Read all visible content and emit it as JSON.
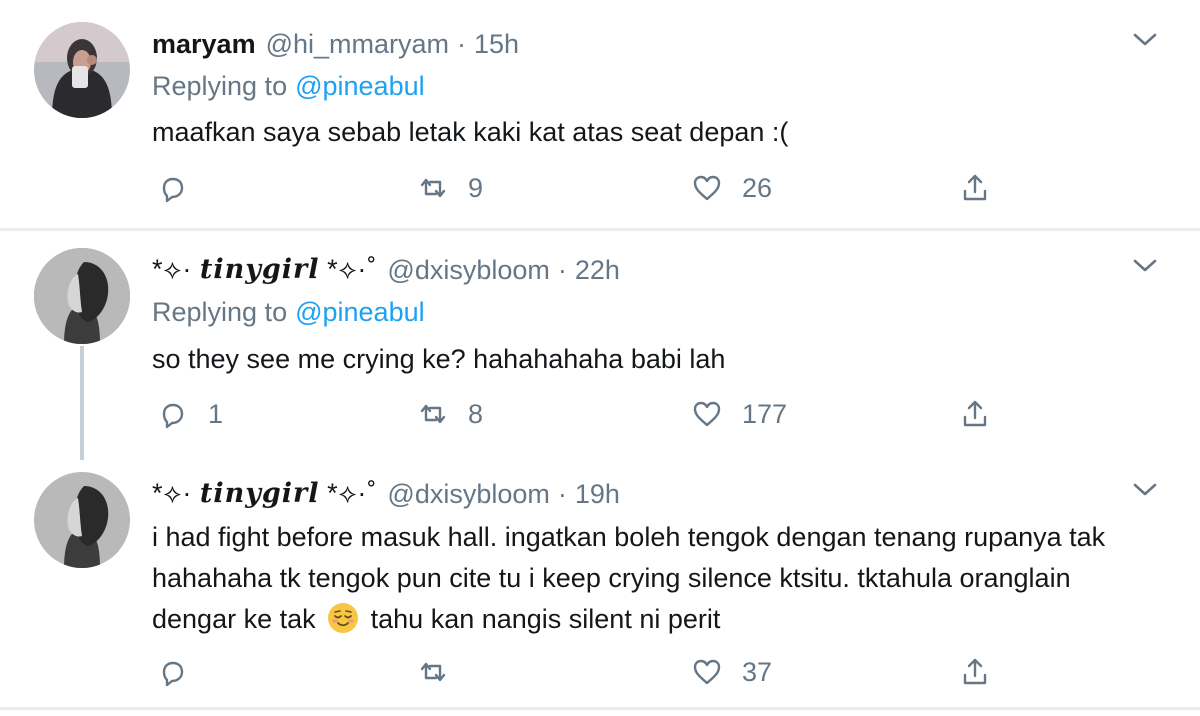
{
  "tweets": [
    {
      "name": "maryam",
      "handle": "@hi_mmaryam",
      "separator": "·",
      "time": "15h",
      "replying_label": "Replying to",
      "replying_to": "@pineabul",
      "text": "maafkan saya sebab letak kaki kat atas seat depan :(",
      "replies": "",
      "retweets": "9",
      "likes": "26"
    },
    {
      "name_prefix": "*⟡·",
      "name_styled": "tinygirl",
      "name_suffix": "*⟡·˚",
      "handle": "@dxisybloom",
      "separator": "·",
      "time": "22h",
      "replying_label": "Replying to",
      "replying_to": "@pineabul",
      "text": "so they see me crying ke? hahahahaha babi lah",
      "replies": "1",
      "retweets": "8",
      "likes": "177"
    },
    {
      "name_prefix": "*⟡·",
      "name_styled": "tinygirl",
      "name_suffix": "*⟡·˚",
      "handle": "@dxisybloom",
      "separator": "·",
      "time": "19h",
      "text_before_emoji": "i had fight before masuk hall. ingatkan boleh tengok dengan tenang rupanya tak hahahaha tk tengok pun cite tu i keep crying silence ktsitu. tktahula oranglain dengar ke tak",
      "emoji": "relieved-face-emoji",
      "text_after_emoji": "tahu kan nangis silent ni perit",
      "replies": "",
      "retweets": "",
      "likes": "37"
    }
  ],
  "icons": {
    "reply": "reply-icon",
    "retweet": "retweet-icon",
    "like": "heart-icon",
    "share": "share-icon",
    "more": "chevron-down-icon"
  },
  "colors": {
    "text": "#14171a",
    "secondary": "#657786",
    "link": "#1da1f2",
    "divider": "#e6ecf0",
    "thread_line": "#c4cfd6"
  }
}
